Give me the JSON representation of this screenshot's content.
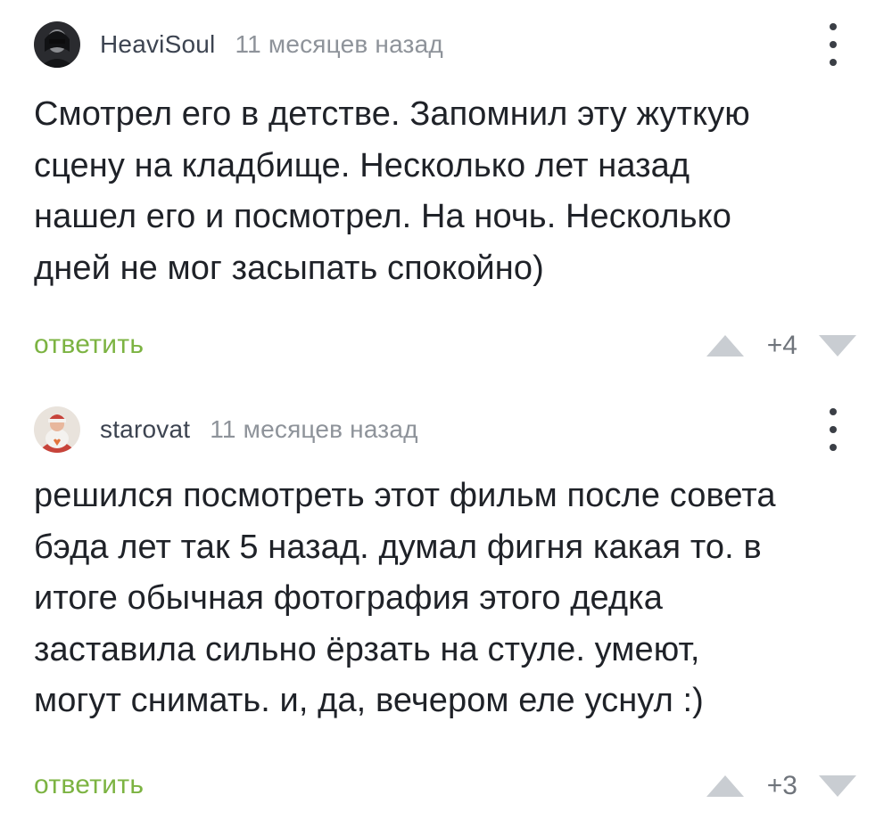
{
  "comments": [
    {
      "username": "HeaviSoul",
      "timestamp": "11 месяцев назад",
      "text": "Смотрел его в детстве. Запомнил эту жуткую\nсцену на кладбище. Несколько лет назад\nнашел его и посмотрел. На ночь. Несколько\nдней не мог засыпать спокойно)",
      "reply_label": "ответить",
      "score": "+4",
      "icons": {
        "menu": "more-vertical-icon",
        "upvote": "triangle-up-icon",
        "downvote": "triangle-down-icon"
      }
    },
    {
      "username": "starovat",
      "timestamp": "11 месяцев назад",
      "text": "решился посмотреть этот фильм после совета\nбэда лет так 5 назад. думал фигня какая то. в\nитоге обычная фотография этого дедка\nзаставила сильно ёрзать на стуле. умеют,\nмогут снимать. и, да, вечером еле уснул :)",
      "reply_label": "ответить",
      "score": "+3",
      "icons": {
        "menu": "more-vertical-icon",
        "upvote": "triangle-up-icon",
        "downvote": "triangle-down-icon"
      }
    }
  ],
  "colors": {
    "reply": "#7cb342",
    "username": "#3d4451",
    "timestamp": "#8e939a",
    "text": "#1f2228",
    "vote_arrow": "#c9cdd2"
  }
}
